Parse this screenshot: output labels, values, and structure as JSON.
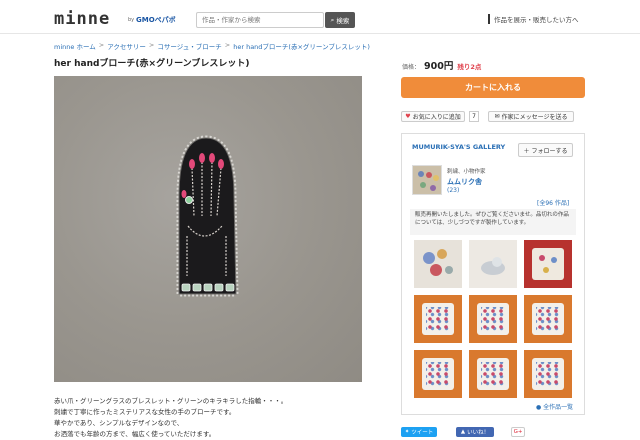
{
  "header": {
    "logo": "minne",
    "logo_by": "by",
    "logo_gmo": "GMOペパボ",
    "search_placeholder": "作品・作家から検索",
    "search_button": "検索",
    "right_link": "作品を展示・販売したい方へ"
  },
  "breadcrumb": [
    "minne ホーム",
    "アクセサリー",
    "コサージュ・ブローチ",
    "her handブローチ(赤×グリーンブレスレット)"
  ],
  "product": {
    "title": "her handブローチ(赤×グリーンブレスレット)",
    "price_label": "価格：",
    "price": "900円",
    "stock": "残り2点",
    "cart_button": "カートに入れる",
    "favorite_button": "お気に入りに追加",
    "favorite_count": "7",
    "message_button": "作家にメッセージを送る",
    "description": [
      "赤い爪・グリーングラスのブレスレット・グリーンのキラキラした指輪・・・。",
      "刺繍で丁寧に作ったミステリアスな女性の手のブローチです。",
      "華やかであり、シンプルなデザインなので、",
      "お洒落でも年齢の方まで、幅広く使っていただけます。"
    ]
  },
  "gallery": {
    "title": "MUMURIK-SYA'S GALLERY",
    "follow_button": "フォローする",
    "role": "刺繍、小物作家",
    "name": "ムムリク舎",
    "count": "(23)",
    "all_works_count": "[全96 作品]",
    "notice": "販売再開いたしました。ぜひご覧くださいませ。品切れの作品については、少しづつですが製作しています。",
    "all_link": "全作品一覧"
  },
  "social": {
    "tweet": "ツイート",
    "like": "いいね！",
    "gplus": "G+"
  },
  "colors": {
    "accent_orange": "#f08c3a",
    "link_blue": "#2a6fb5",
    "stock_red": "#e0434e"
  }
}
